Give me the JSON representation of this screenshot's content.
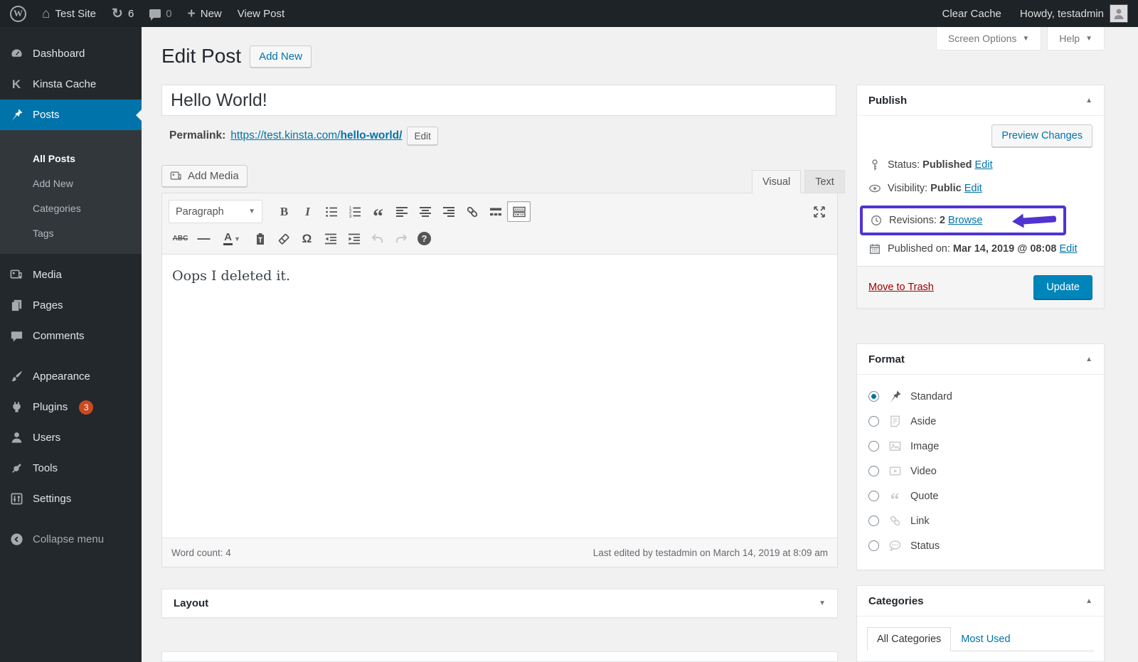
{
  "admin_bar": {
    "wp_logo_letter": "W",
    "site_name": "Test Site",
    "updates_count": "6",
    "comments_count": "0",
    "new_label": "New",
    "view_post": "View Post",
    "clear_cache": "Clear Cache",
    "howdy": "Howdy, testadmin"
  },
  "screen_tabs": {
    "screen_options": "Screen Options",
    "help": "Help"
  },
  "sidebar": {
    "dashboard": "Dashboard",
    "kinsta": "Kinsta Cache",
    "kinsta_letter": "K",
    "posts": "Posts",
    "all_posts": "All Posts",
    "add_new": "Add New",
    "categories": "Categories",
    "tags": "Tags",
    "media": "Media",
    "pages": "Pages",
    "comments": "Comments",
    "appearance": "Appearance",
    "plugins": "Plugins",
    "plugins_badge": "3",
    "users": "Users",
    "tools": "Tools",
    "settings": "Settings",
    "collapse": "Collapse menu"
  },
  "page": {
    "title": "Edit Post",
    "add_new": "Add New"
  },
  "post": {
    "title": "Hello World!",
    "permalink_label": "Permalink:",
    "permalink_base": "https://test.kinsta.com/",
    "permalink_slug": "hello-world/",
    "permalink_edit": "Edit",
    "content": "Oops I deleted it."
  },
  "editor": {
    "add_media": "Add Media",
    "visual": "Visual",
    "text": "Text",
    "paragraph": "Paragraph",
    "bold": "B",
    "italic": "I",
    "strike": "ABC",
    "hr": "—",
    "color_letter": "A",
    "omega": "Ω",
    "quote_glyph": "“",
    "help": "?",
    "word_count": "Word count: 4",
    "last_edited": "Last edited by testadmin on March 14, 2019 at 8:09 am"
  },
  "layout_box": {
    "title": "Layout"
  },
  "publish": {
    "title": "Publish",
    "preview": "Preview Changes",
    "status_label": "Status:",
    "status_value": "Published",
    "edit": "Edit",
    "visibility_label": "Visibility:",
    "visibility_value": "Public",
    "revisions_label": "Revisions:",
    "revisions_value": "2",
    "browse": "Browse",
    "published_label": "Published on:",
    "published_value": "Mar 14, 2019 @ 08:08",
    "trash": "Move to Trash",
    "update": "Update"
  },
  "format": {
    "title": "Format",
    "standard": "Standard",
    "aside": "Aside",
    "image": "Image",
    "video": "Video",
    "quote": "Quote",
    "quote_glyph": "“",
    "link": "Link",
    "status": "Status"
  },
  "categories": {
    "title": "Categories",
    "tab_all": "All Categories",
    "tab_most": "Most Used"
  },
  "colors": {
    "admin_accent": "#0073aa",
    "update_button": "#0085ba",
    "highlight_purple": "#5133d1",
    "badge_orange": "#ca4a1f",
    "trash_red": "#a00000"
  }
}
